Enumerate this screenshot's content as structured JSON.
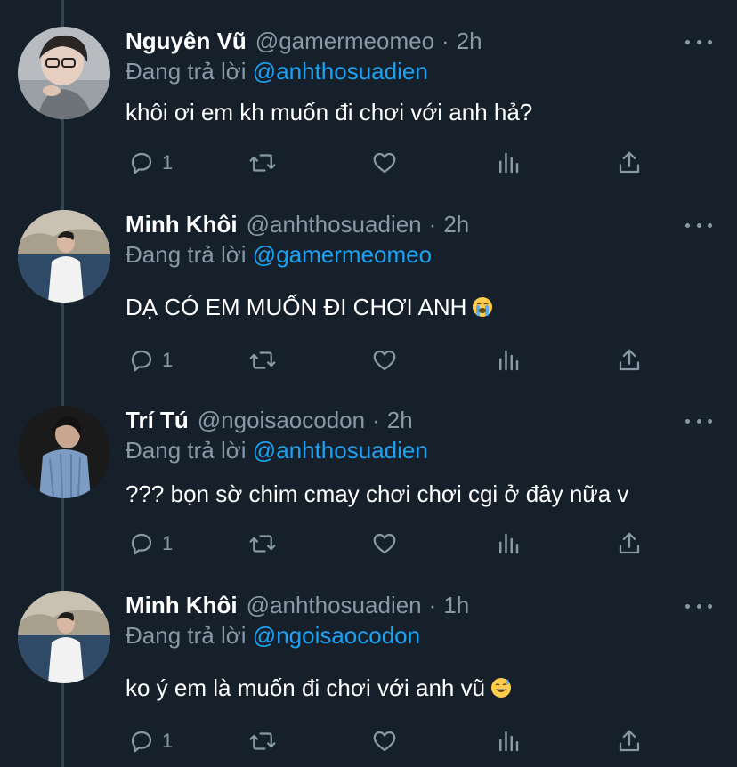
{
  "reply_prefix": "Đang trả lời",
  "tweets": [
    {
      "name": "Nguyên Vũ",
      "handle": "@gamermeomeo",
      "time": "2h",
      "reply_to": "@anhthosuadien",
      "text": "khôi ơi em kh muốn đi chơi với anh hả?",
      "emoji": "",
      "reply_count": "1"
    },
    {
      "name": "Minh Khôi",
      "handle": "@anhthosuadien",
      "time": "2h",
      "reply_to": "@gamermeomeo",
      "text": "DẠ CÓ EM MUỐN ĐI CHƠI ANH",
      "emoji": "loudly-crying-face-emoji",
      "reply_count": "1"
    },
    {
      "name": "Trí Tú",
      "handle": "@ngoisaocodon",
      "time": "2h",
      "reply_to": "@anhthosuadien",
      "text": "??? bọn sờ chim cmay chơi chơi cgi ở đây nữa v",
      "emoji": "",
      "reply_count": "1"
    },
    {
      "name": "Minh Khôi",
      "handle": "@anhthosuadien",
      "time": "1h",
      "reply_to": "@ngoisaocodon",
      "text": "ko ý em là muốn đi chơi với anh vũ",
      "emoji": "grinning-face-with-sweat-emoji",
      "reply_count": "1"
    }
  ],
  "icons": {
    "reply": "comment-bubble-icon",
    "retweet": "retweet-icon",
    "like": "heart-icon",
    "analytics": "bar-chart-icon",
    "share": "share-upload-icon",
    "more": "more-horizontal-icon"
  },
  "colors": {
    "background": "#15202b",
    "primary_text": "#ffffff",
    "secondary_text": "#8899a6",
    "link": "#1da1f2",
    "thread_line": "#38444d"
  }
}
